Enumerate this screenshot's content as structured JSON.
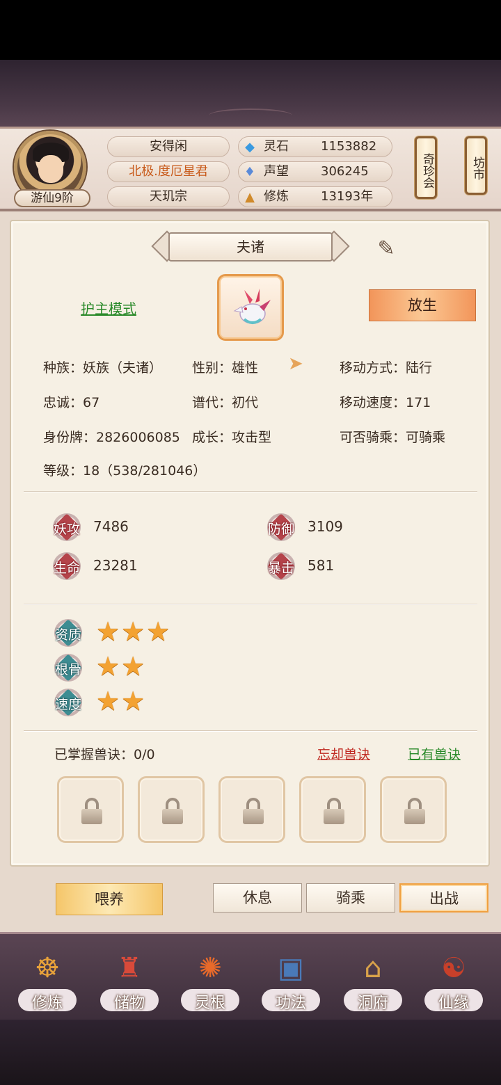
{
  "header": {
    "rank": "游仙9阶",
    "names": [
      "安得闲",
      "北极.度厄星君",
      "天玑宗"
    ],
    "resources": [
      {
        "icon": "spirit-stone-icon",
        "label": "灵石",
        "value": "1153882"
      },
      {
        "icon": "reputation-icon",
        "label": "声望",
        "value": "306245"
      },
      {
        "icon": "cultivation-icon",
        "label": "修炼",
        "value": "13193年"
      }
    ],
    "qizhenhui": "奇珍会",
    "fangshi": "坊市"
  },
  "pet": {
    "name": "夫诸",
    "guard_mode": "护主模式",
    "release": "放生",
    "info": {
      "race": "种族：妖族（夫诸）",
      "gender": "性别：雄性",
      "move_type": "移动方式：陆行",
      "loyalty": "忠诚：67",
      "generation": "谱代：初代",
      "move_speed": "移动速度：171",
      "id_tag": "身份牌：2826006085",
      "growth": "成长：攻击型",
      "rideable": "可否骑乘：可骑乘",
      "level": "等级：18（538/281046）"
    },
    "stats": [
      {
        "label": "妖攻",
        "value": "7486"
      },
      {
        "label": "防御",
        "value": "3109"
      },
      {
        "label": "生命",
        "value": "23281"
      },
      {
        "label": "暴击",
        "value": "581"
      }
    ],
    "aptitudes": [
      {
        "label": "资质",
        "stars": 3
      },
      {
        "label": "根骨",
        "stars": 2
      },
      {
        "label": "速度",
        "stars": 2
      }
    ],
    "skills": {
      "mastered": "已掌握兽诀：0/0",
      "forget": "忘却兽诀",
      "owned": "已有兽诀"
    }
  },
  "actions": {
    "feed": "喂养",
    "rest": "休息",
    "ride": "骑乘",
    "battle": "出战"
  },
  "nav": [
    "修炼",
    "储物",
    "灵根",
    "功法",
    "洞府",
    "仙缘"
  ]
}
